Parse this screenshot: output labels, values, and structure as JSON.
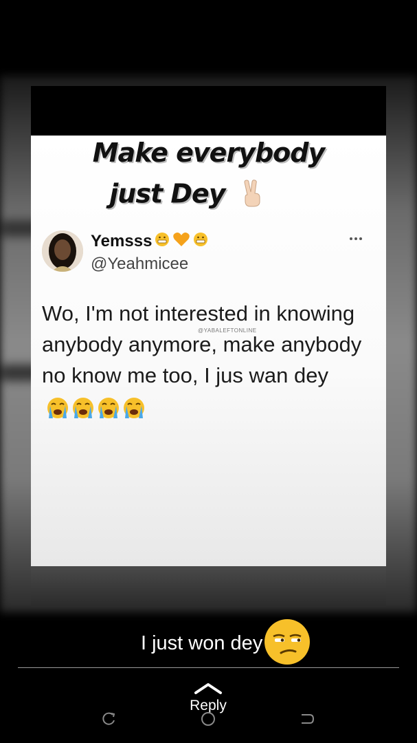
{
  "status_image": {
    "headline_line1": "Make everybody",
    "headline_line2": "just Dey",
    "headline_icon": "victory-hand-icon",
    "tweet": {
      "user_name": "Yemsss",
      "name_emojis": [
        "grimacing-face-icon",
        "orange-heart-icon",
        "grimacing-face-icon"
      ],
      "handle": "@Yeahmicee",
      "more_icon": "more-dots-icon",
      "text": "Wo, I'm not interested in knowing anybody anymore, make anybody no know me too, I jus wan dey",
      "text_emojis": [
        "loudly-crying-face-icon",
        "loudly-crying-face-icon",
        "loudly-crying-face-icon",
        "loudly-crying-face-icon"
      ],
      "watermark": "@YABALEFTONLINE"
    }
  },
  "caption": {
    "text": "I just won dey",
    "emoji": "unamused-face-icon"
  },
  "reply": {
    "label": "Reply",
    "icon": "chevron-up-icon"
  },
  "nav": {
    "recent_icon": "recent-apps-icon",
    "home_icon": "home-icon",
    "back_icon": "back-icon"
  },
  "colors": {
    "background": "#000000",
    "caption_text": "#ffffff",
    "emoji_yellow": "#f7c02a",
    "emoji_orange": "#f5a21b",
    "tear_blue": "#4aa8e8"
  }
}
